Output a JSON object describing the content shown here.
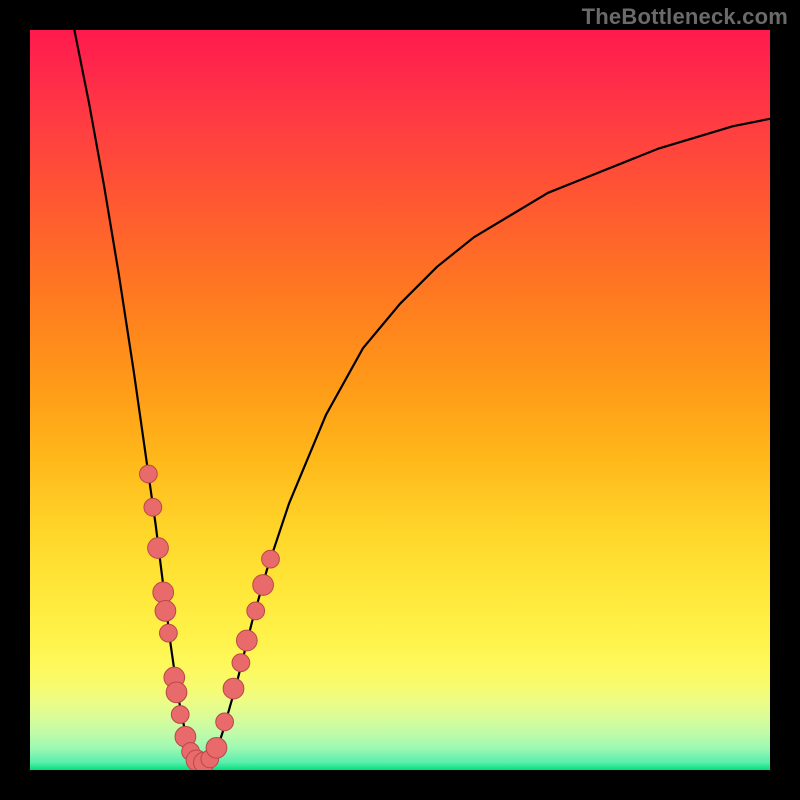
{
  "watermark": "TheBottleneck.com",
  "colors": {
    "frame": "#000000",
    "curve": "#000000",
    "dot_fill": "#e86a6a",
    "dot_stroke": "#b84848",
    "gradient_top": "#ff1a4d",
    "gradient_bottom": "#00e07a"
  },
  "chart_data": {
    "type": "line",
    "title": "",
    "xlabel": "",
    "ylabel": "",
    "xlim": [
      0,
      100
    ],
    "ylim": [
      0,
      100
    ],
    "grid": false,
    "legend": false,
    "series": [
      {
        "name": "bottleneck-curve",
        "x": [
          6,
          8,
          10,
          12,
          14,
          15,
          16,
          17,
          18,
          19,
          20,
          21,
          22,
          23,
          24,
          25,
          26,
          28,
          30,
          32,
          35,
          40,
          45,
          50,
          55,
          60,
          65,
          70,
          75,
          80,
          85,
          90,
          95,
          100
        ],
        "y": [
          100,
          90,
          79,
          67,
          54,
          47,
          40,
          33,
          25,
          17,
          10,
          5,
          2,
          1,
          1,
          2,
          5,
          12,
          20,
          27,
          36,
          48,
          57,
          63,
          68,
          72,
          75,
          78,
          80,
          82,
          84,
          85.5,
          87,
          88
        ]
      }
    ],
    "markers": [
      {
        "x": 16.0,
        "y": 40.0,
        "r": 1.2
      },
      {
        "x": 16.6,
        "y": 35.5,
        "r": 1.2
      },
      {
        "x": 17.3,
        "y": 30.0,
        "r": 1.4
      },
      {
        "x": 18.0,
        "y": 24.0,
        "r": 1.4
      },
      {
        "x": 18.3,
        "y": 21.5,
        "r": 1.4
      },
      {
        "x": 18.7,
        "y": 18.5,
        "r": 1.2
      },
      {
        "x": 19.5,
        "y": 12.5,
        "r": 1.4
      },
      {
        "x": 19.8,
        "y": 10.5,
        "r": 1.4
      },
      {
        "x": 20.3,
        "y": 7.5,
        "r": 1.2
      },
      {
        "x": 21.0,
        "y": 4.5,
        "r": 1.4
      },
      {
        "x": 21.7,
        "y": 2.5,
        "r": 1.2
      },
      {
        "x": 22.5,
        "y": 1.3,
        "r": 1.4
      },
      {
        "x": 23.5,
        "y": 1.0,
        "r": 1.4
      },
      {
        "x": 24.3,
        "y": 1.5,
        "r": 1.2
      },
      {
        "x": 25.2,
        "y": 3.0,
        "r": 1.4
      },
      {
        "x": 26.3,
        "y": 6.5,
        "r": 1.2
      },
      {
        "x": 27.5,
        "y": 11.0,
        "r": 1.4
      },
      {
        "x": 28.5,
        "y": 14.5,
        "r": 1.2
      },
      {
        "x": 29.3,
        "y": 17.5,
        "r": 1.4
      },
      {
        "x": 30.5,
        "y": 21.5,
        "r": 1.2
      },
      {
        "x": 31.5,
        "y": 25.0,
        "r": 1.4
      },
      {
        "x": 32.5,
        "y": 28.5,
        "r": 1.2
      }
    ]
  }
}
